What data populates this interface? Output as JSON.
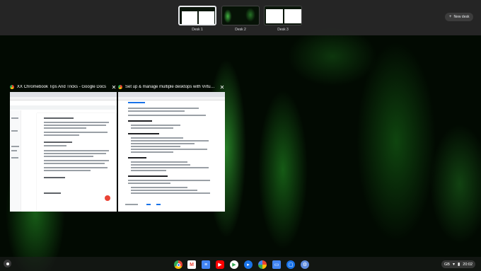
{
  "desks": [
    {
      "label": "Desk 1",
      "active": true
    },
    {
      "label": "Desk 2",
      "active": false
    },
    {
      "label": "Desk 3",
      "active": false
    }
  ],
  "new_desk": {
    "icon": "plus-icon",
    "label": "New desk"
  },
  "windows": [
    {
      "title": "XX Chromebook Tips And Tricks - Google Docs",
      "favicon": "chrome-icon"
    },
    {
      "title": "Set up & manage multiple desktops with Virtual Des...",
      "favicon": "chrome-icon"
    }
  ],
  "shelf": {
    "apps": [
      {
        "name": "chrome-icon",
        "color": "#ffffff"
      },
      {
        "name": "gmail-icon",
        "color": "#ffffff"
      },
      {
        "name": "docs-icon",
        "color": "#4285f4"
      },
      {
        "name": "youtube-icon",
        "color": "#ff0000"
      },
      {
        "name": "play-store-icon",
        "color": "#ffffff"
      },
      {
        "name": "duo-icon",
        "color": "#1a73e8"
      },
      {
        "name": "photos-icon",
        "color": "#ffffff"
      },
      {
        "name": "files-icon",
        "color": "#4285f4"
      },
      {
        "name": "messages-icon",
        "color": "#1a73e8"
      },
      {
        "name": "settings-icon",
        "color": "#5f8cde"
      }
    ]
  },
  "status": {
    "locale": "GB",
    "time": "20:02"
  }
}
